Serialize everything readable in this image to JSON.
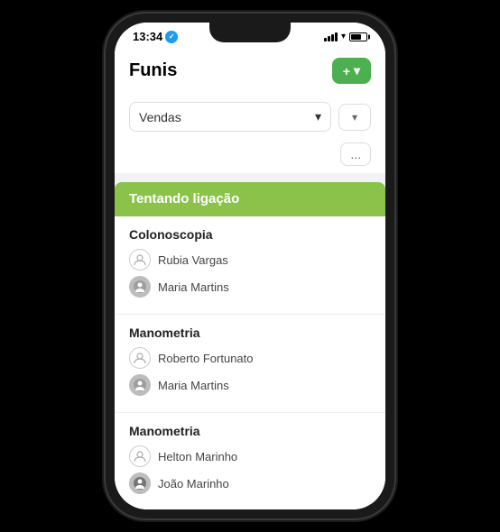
{
  "phone": {
    "status_bar": {
      "time": "13:34",
      "verified_icon": "✓",
      "wifi": "wifi",
      "battery": "battery"
    },
    "header": {
      "title": "Funis",
      "add_button_label": "+ +"
    },
    "filter": {
      "select_label": "Vendas",
      "chevron_down": "▾",
      "filter_icon": "▾",
      "more_label": "..."
    },
    "kanban": {
      "column_label": "Tentando ligação",
      "groups": [
        {
          "title": "Colonoscopia",
          "people": [
            {
              "name": "Rubia Vargas",
              "type": "icon"
            },
            {
              "name": "Maria Martins",
              "type": "face"
            }
          ]
        },
        {
          "title": "Manometria",
          "people": [
            {
              "name": "Roberto Fortunato",
              "type": "icon"
            },
            {
              "name": "Maria Martins",
              "type": "face"
            }
          ]
        },
        {
          "title": "Manometria",
          "people": [
            {
              "name": "Helton Marinho",
              "type": "icon"
            },
            {
              "name": "João Marinho",
              "type": "face-alt"
            }
          ]
        }
      ]
    }
  }
}
